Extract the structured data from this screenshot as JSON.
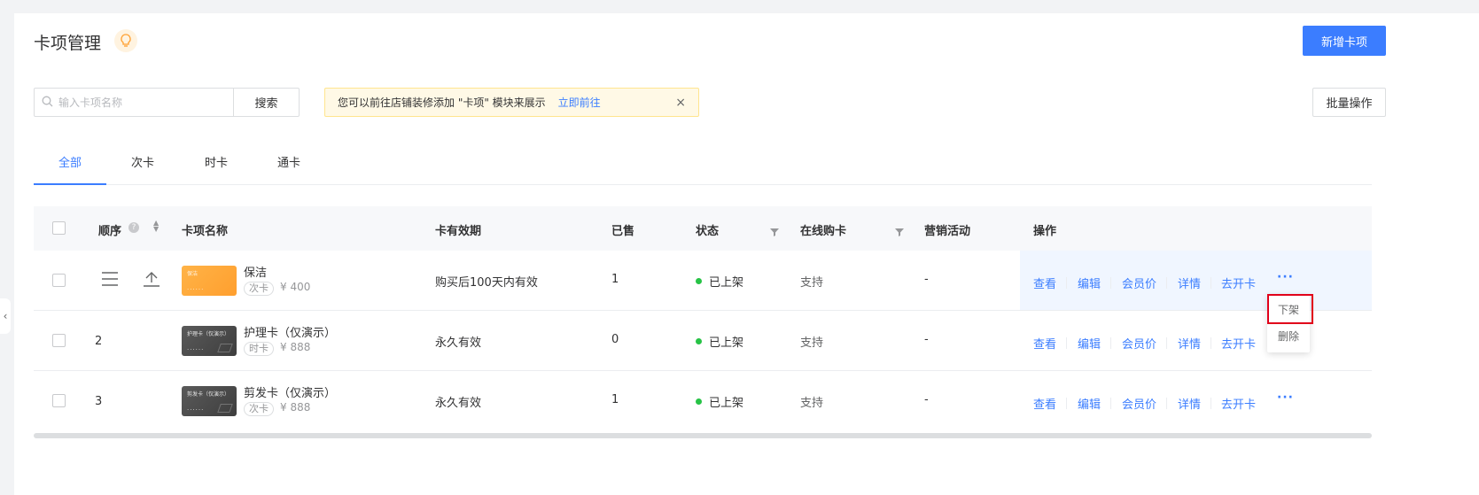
{
  "header": {
    "title": "卡项管理",
    "new_button": "新增卡项",
    "batch_button": "批量操作"
  },
  "search": {
    "placeholder": "输入卡项名称",
    "button": "搜索"
  },
  "notice": {
    "text": "您可以前往店铺装修添加 \"卡项\" 模块来展示",
    "link": "立即前往",
    "close": "×"
  },
  "tabs": [
    {
      "label": "全部",
      "active": true
    },
    {
      "label": "次卡"
    },
    {
      "label": "时卡"
    },
    {
      "label": "通卡"
    }
  ],
  "table": {
    "headers": {
      "order": "顺序",
      "name": "卡项名称",
      "validity": "卡有效期",
      "sold": "已售",
      "status": "状态",
      "online": "在线购卡",
      "marketing": "营销活动",
      "actions": "操作"
    },
    "rows": [
      {
        "order": "",
        "name": "保洁",
        "tag": "次卡",
        "price": "¥ 400",
        "thumb_label": "保洁",
        "validity": "购买后100天内有效",
        "sold": "1",
        "status": "已上架",
        "online": "支持",
        "marketing": "-"
      },
      {
        "order": "2",
        "name": "护理卡（仅演示）",
        "tag": "时卡",
        "price": "¥ 888",
        "thumb_label": "护理卡（仅演示）",
        "validity": "永久有效",
        "sold": "0",
        "status": "已上架",
        "online": "支持",
        "marketing": "-"
      },
      {
        "order": "3",
        "name": "剪发卡（仅演示）",
        "tag": "次卡",
        "price": "¥ 888",
        "thumb_label": "剪发卡（仅演示）",
        "validity": "永久有效",
        "sold": "1",
        "status": "已上架",
        "online": "支持",
        "marketing": "-"
      }
    ],
    "actions": {
      "view": "查看",
      "edit": "编辑",
      "member_price": "会员价",
      "detail": "详情",
      "open_card": "去开卡",
      "more": "···"
    }
  },
  "popup": {
    "off_shelf": "下架",
    "delete": "删除"
  },
  "colors": {
    "primary": "#3b7dff",
    "status_green": "#27c346",
    "highlight_red": "#e1001a"
  }
}
